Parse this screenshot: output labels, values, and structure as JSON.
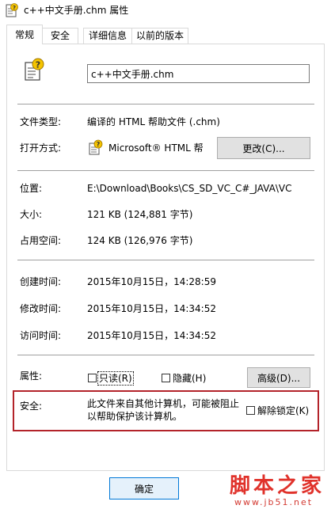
{
  "window": {
    "title": "c++中文手册.chm 属性"
  },
  "tabs": [
    {
      "label": "常规",
      "active": true
    },
    {
      "label": "安全",
      "active": false
    },
    {
      "label": "详细信息",
      "active": false
    },
    {
      "label": "以前的版本",
      "active": false
    }
  ],
  "file": {
    "icon": "chm-help-file-icon",
    "name": "c++中文手册.chm"
  },
  "general": {
    "file_type_label": "文件类型:",
    "file_type_value": "编译的 HTML 帮助文件 (.chm)",
    "open_with_label": "打开方式:",
    "open_with_value": "Microsoft® HTML 帮",
    "change_button": "更改(C)...",
    "location_label": "位置:",
    "location_value": "E:\\Download\\Books\\CS_SD_VC_C#_JAVA\\VC",
    "size_label": "大小:",
    "size_value": "121 KB (124,881 字节)",
    "disk_size_label": "占用空间:",
    "disk_size_value": "124 KB (126,976 字节)",
    "created_label": "创建时间:",
    "created_value": "2015年10月15日，14:28:59",
    "modified_label": "修改时间:",
    "modified_value": "2015年10月15日，14:34:52",
    "accessed_label": "访问时间:",
    "accessed_value": "2015年10月15日，14:34:52"
  },
  "attributes": {
    "label": "属性:",
    "readonly_label": "只读(R)",
    "readonly_checked": false,
    "hidden_label": "隐藏(H)",
    "hidden_checked": false,
    "advanced_button": "高级(D)..."
  },
  "security": {
    "label": "安全:",
    "message": "此文件来自其他计算机，可能被阻止以帮助保护该计算机。",
    "unblock_label": "解除锁定(K)",
    "unblock_checked": false,
    "highlight_color": "#b3232a"
  },
  "footer": {
    "ok_button": "确定"
  },
  "watermark": {
    "logo": "脚本之家",
    "url": "www.jb51.net",
    "color": "#e0322b"
  }
}
